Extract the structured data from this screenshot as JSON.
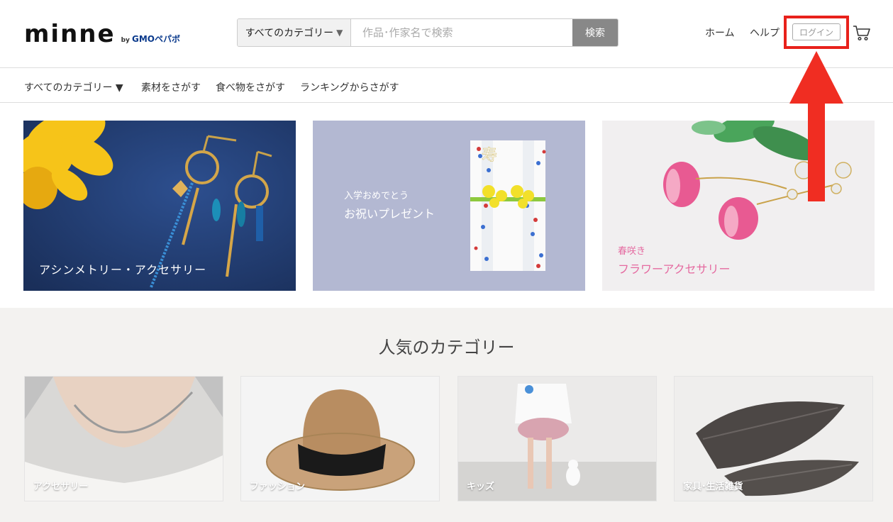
{
  "header": {
    "logo": "minne",
    "logo_by": "by",
    "logo_brand": "GMOペパボ",
    "search": {
      "category": "すべてのカテゴリー",
      "placeholder": "作品･作家名で検索",
      "button": "検索"
    },
    "nav": {
      "home": "ホーム",
      "help": "ヘルプ",
      "login": "ログイン"
    }
  },
  "subnav": {
    "items": [
      "すべてのカテゴリー ▼",
      "素材をさがす",
      "食べ物をさがす",
      "ランキングからさがす"
    ]
  },
  "banners": [
    {
      "title": "アシンメトリー・アクセサリー"
    },
    {
      "subtitle": "入学おめでとう",
      "title": "お祝いプレゼント",
      "envelope_char": "寿"
    },
    {
      "subtitle": "春咲き",
      "title": "フラワーアクセサリー"
    }
  ],
  "popular": {
    "title": "人気のカテゴリー",
    "categories": [
      "アクセサリー",
      "ファッション",
      "キッズ",
      "家具･生活雑貨"
    ]
  },
  "colors": {
    "highlight": "#e8211b",
    "search_button": "#888888",
    "pink_text": "#e56aa0"
  }
}
